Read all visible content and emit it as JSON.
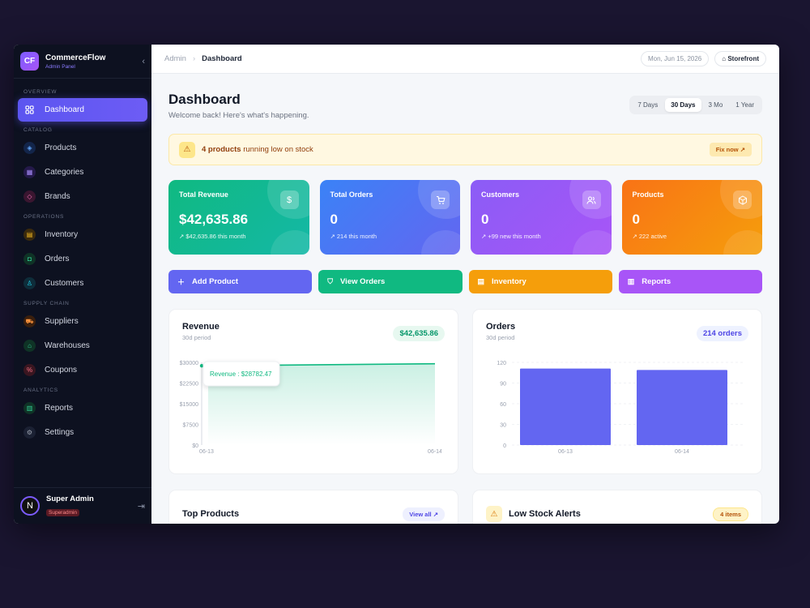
{
  "sidebar": {
    "brand": {
      "logo": "CF",
      "name": "CommerceFlow",
      "subtitle": "Admin Panel"
    },
    "sections": {
      "overview": "OVERVIEW",
      "catalog": "CATALOG",
      "operations": "OPERATIONS",
      "supply": "SUPPLY CHAIN",
      "analytics": "ANALYTICS"
    },
    "items": {
      "dashboard": "Dashboard",
      "products": "Products",
      "categories": "Categories",
      "brands": "Brands",
      "inventory": "Inventory",
      "orders": "Orders",
      "customers": "Customers",
      "suppliers": "Suppliers",
      "warehouses": "Warehouses",
      "coupons": "Coupons",
      "reports": "Reports",
      "settings": "Settings"
    },
    "user": {
      "initial": "N",
      "name": "Super Admin",
      "role": "Superadmin"
    }
  },
  "topbar": {
    "crumb_root": "Admin",
    "crumb_current": "Dashboard",
    "date": "Mon, Jun 15, 2026",
    "storefront": "Storefront"
  },
  "header": {
    "title": "Dashboard",
    "subtitle": "Welcome back! Here's what's happening."
  },
  "ranges": [
    "7 Days",
    "30 Days",
    "3 Mo",
    "1 Year"
  ],
  "alert": {
    "count": "4 products",
    "text": " running low on stock",
    "action": "Fix now ↗"
  },
  "stats": [
    {
      "label": "Total Revenue",
      "value": "$42,635.86",
      "sub": "↗ $42,635.86 this month"
    },
    {
      "label": "Total Orders",
      "value": "0",
      "sub": "↗ 214 this month"
    },
    {
      "label": "Customers",
      "value": "0",
      "sub": "↗ +99 new this month"
    },
    {
      "label": "Products",
      "value": "0",
      "sub": "↗ 222 active"
    }
  ],
  "actions": {
    "add_product": "Add Product",
    "view_orders": "View Orders",
    "inventory": "Inventory",
    "reports": "Reports"
  },
  "revenue_panel": {
    "title": "Revenue",
    "period": "30d period",
    "badge": "$42,635.86",
    "tooltip": "Revenue : $28782.47"
  },
  "orders_panel": {
    "title": "Orders",
    "period": "30d period",
    "badge": "214 orders"
  },
  "top_products": {
    "title": "Top Products",
    "action": "View all ↗"
  },
  "low_stock": {
    "title": "Low Stock Alerts",
    "badge": "4 items"
  },
  "colors": {
    "accent": "#5b55f0",
    "revenue": "#10b981",
    "orders": "#6366f1",
    "customers": "#a855f7",
    "products": "#f97316"
  },
  "chart_data": [
    {
      "type": "area",
      "title": "Revenue",
      "x": [
        "06-13",
        "06-14"
      ],
      "values": [
        28782.47,
        29500
      ],
      "yticks": [
        "$0",
        "$7500",
        "$15000",
        "$22500",
        "$30000"
      ],
      "ylim": [
        0,
        30000
      ]
    },
    {
      "type": "bar",
      "title": "Orders",
      "categories": [
        "06-13",
        "06-14"
      ],
      "values": [
        111,
        109
      ],
      "yticks": [
        "0",
        "30",
        "60",
        "90",
        "120"
      ],
      "ylim": [
        0,
        120
      ]
    }
  ]
}
